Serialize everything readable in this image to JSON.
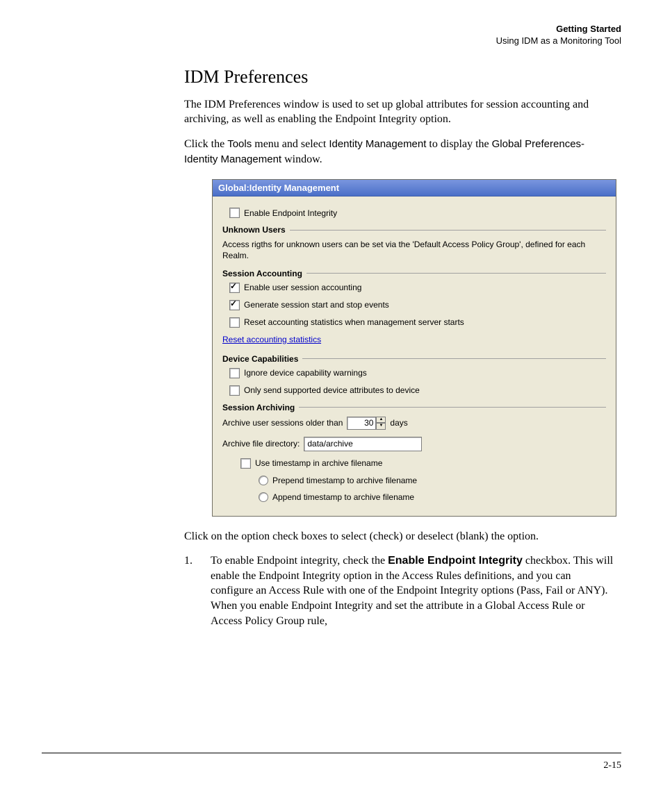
{
  "header": {
    "bold": "Getting Started",
    "sub": "Using IDM as a Monitoring Tool"
  },
  "title": "IDM Preferences",
  "para1": "The IDM Preferences window is used to set up global attributes for session accounting and archiving, as well as enabling the Endpoint Integrity option.",
  "para2": {
    "pre": "Click the ",
    "tools": "Tools",
    "mid1": " menu and select ",
    "idmgmt": "Identity Management",
    "mid2": " to display the ",
    "globpref": "Global Preferences-Identity Management",
    "post": " window."
  },
  "dialog": {
    "title": "Global:Identity Management",
    "enable_ei": "Enable Endpoint Integrity",
    "unknown_users": {
      "label": "Unknown Users",
      "desc": "Access rigths for unknown users can be set via the 'Default Access Policy Group', defined for each Realm."
    },
    "session_acct": {
      "label": "Session Accounting",
      "c1": "Enable user session accounting",
      "c2": "Generate session start and stop events",
      "c3": "Reset accounting statistics when management server starts",
      "link": "Reset accounting statistics"
    },
    "dev_caps": {
      "label": "Device Capabilities",
      "c1": "Ignore device capability warnings",
      "c2": "Only send supported device attributes to device"
    },
    "session_arch": {
      "label": "Session Archiving",
      "row1_pre": "Archive user sessions older than",
      "row1_val": "30",
      "row1_post": "days",
      "row2_label": "Archive file directory:",
      "row2_val": "data/archive",
      "c_ts": "Use timestamp in archive filename",
      "r1": "Prepend timestamp to archive filename",
      "r2": "Append timestamp to archive filename"
    }
  },
  "para3": "Click on the option check boxes to select (check) or deselect (blank) the option.",
  "step1": {
    "num": "1.",
    "pre": "To enable Endpoint integrity, check the ",
    "bold": "Enable Endpoint Integrity",
    "post": " checkbox. This will enable the Endpoint Integrity option in the Access Rules definitions, and you can configure an Access Rule with one of the Endpoint Integrity options (Pass, Fail or ANY). When you enable Endpoint Integrity and set the attribute in a Global Access Rule or Access Policy Group rule,"
  },
  "page_number": "2-15"
}
